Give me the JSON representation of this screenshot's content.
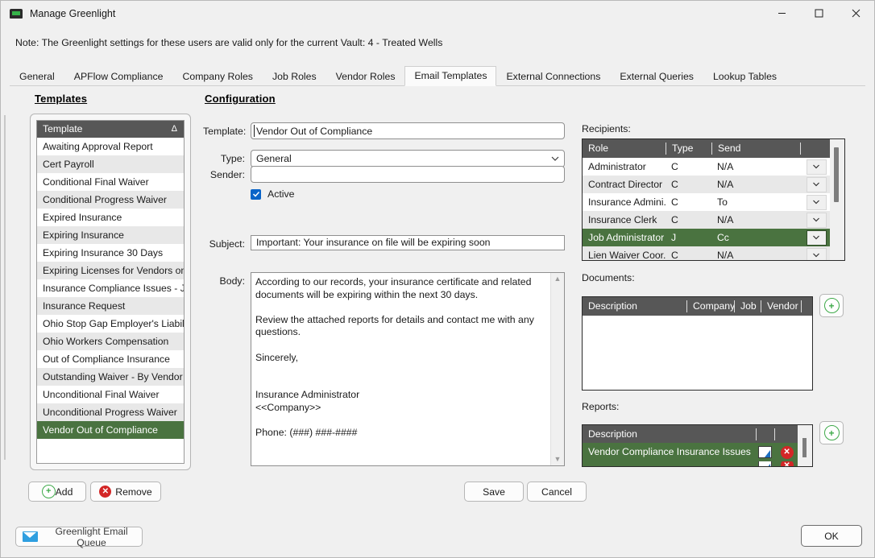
{
  "window": {
    "title": "Manage Greenlight",
    "app_icon": "greenlight-lamp-icon",
    "minimize": "–",
    "maximize": "□",
    "close": "✕"
  },
  "note": "Note:  The Greenlight settings for these users are valid only for the current Vault: 4 - Treated Wells",
  "tabs": [
    {
      "label": "General",
      "active": false
    },
    {
      "label": "APFlow Compliance",
      "active": false
    },
    {
      "label": "Company Roles",
      "active": false
    },
    {
      "label": "Job Roles",
      "active": false
    },
    {
      "label": "Vendor Roles",
      "active": false
    },
    {
      "label": "Email Templates",
      "active": true
    },
    {
      "label": "External Connections",
      "active": false
    },
    {
      "label": "External Queries",
      "active": false
    },
    {
      "label": "Lookup Tables",
      "active": false
    }
  ],
  "templates_panel": {
    "heading": "Templates",
    "column_header": "Template",
    "sort_indicator": "Δ",
    "items": [
      "Awaiting Approval Report",
      "Cert Payroll",
      "Conditional Final Waiver",
      "Conditional Progress Waiver",
      "Expired Insurance",
      "Expiring Insurance",
      "Expiring Insurance 30 Days",
      "Expiring Licenses for Vendors on th...",
      "Insurance Compliance Issues - Job",
      "Insurance Request",
      "Ohio Stop Gap Employer's Liability",
      "Ohio Workers Compensation",
      "Out of Compliance Insurance",
      "Outstanding Waiver - By Vendor By...",
      "Unconditional Final Waiver",
      "Unconditional Progress Waiver",
      "Vendor Out of Compliance"
    ],
    "selected_index": 16,
    "add_label": "Add",
    "remove_label": "Remove",
    "queue_label": "Greenlight Email Queue"
  },
  "configuration": {
    "heading": "Configuration",
    "template_label": "Template:",
    "template_value": "Vendor Out of Compliance",
    "type_label": "Type:",
    "type_value": "General",
    "sender_label": "Sender:",
    "sender_value": "",
    "sender_placeholder": "",
    "active_label": "Active",
    "active_checked": true,
    "subject_label": "Subject:",
    "subject_value": "Important: Your insurance on file will be expiring soon",
    "body_label": "Body:",
    "body_value": "According to our records, your insurance certificate and related documents will be expiring within the next 30 days.\n\nReview the attached reports for details and contact me with any questions.\n\nSincerely,\n\n\nInsurance Administrator\n<<Company>>\n\nPhone: (###) ###-####"
  },
  "recipients": {
    "label": "Recipients:",
    "columns": [
      "Role",
      "Type",
      "Send"
    ],
    "rows": [
      {
        "role": "Administrator",
        "type": "C",
        "send": "N/A",
        "selected": false
      },
      {
        "role": "Contract Director",
        "type": "C",
        "send": "N/A",
        "selected": false
      },
      {
        "role": "Insurance Admini...",
        "type": "C",
        "send": "To",
        "selected": false
      },
      {
        "role": "Insurance Clerk",
        "type": "C",
        "send": "N/A",
        "selected": false
      },
      {
        "role": "Job Administrator",
        "type": "J",
        "send": "Cc",
        "selected": true
      },
      {
        "role": "Lien Waiver Coor...",
        "type": "C",
        "send": "N/A",
        "selected": false
      }
    ]
  },
  "documents": {
    "label": "Documents:",
    "columns": [
      "Description",
      "Company",
      "Job",
      "Vendor",
      ""
    ],
    "rows": [],
    "add_icon": "plus-circle-icon"
  },
  "reports": {
    "label": "Reports:",
    "columns": [
      "Description",
      "",
      ""
    ],
    "rows": [
      {
        "description": "Vendor Compliance Insurance Issues",
        "selected": true
      }
    ],
    "add_icon": "plus-circle-icon",
    "edit_icon": "edit-icon",
    "delete_icon": "delete-circle-icon"
  },
  "footer": {
    "save_label": "Save",
    "cancel_label": "Cancel",
    "ok_label": "OK"
  },
  "colors": {
    "selection_green": "#4a7340",
    "grid_header": "#575757",
    "accent_blue": "#0a64c8",
    "danger_red": "#d32626",
    "add_green": "#3faa4a",
    "window_bg": "#f0f0f0"
  }
}
